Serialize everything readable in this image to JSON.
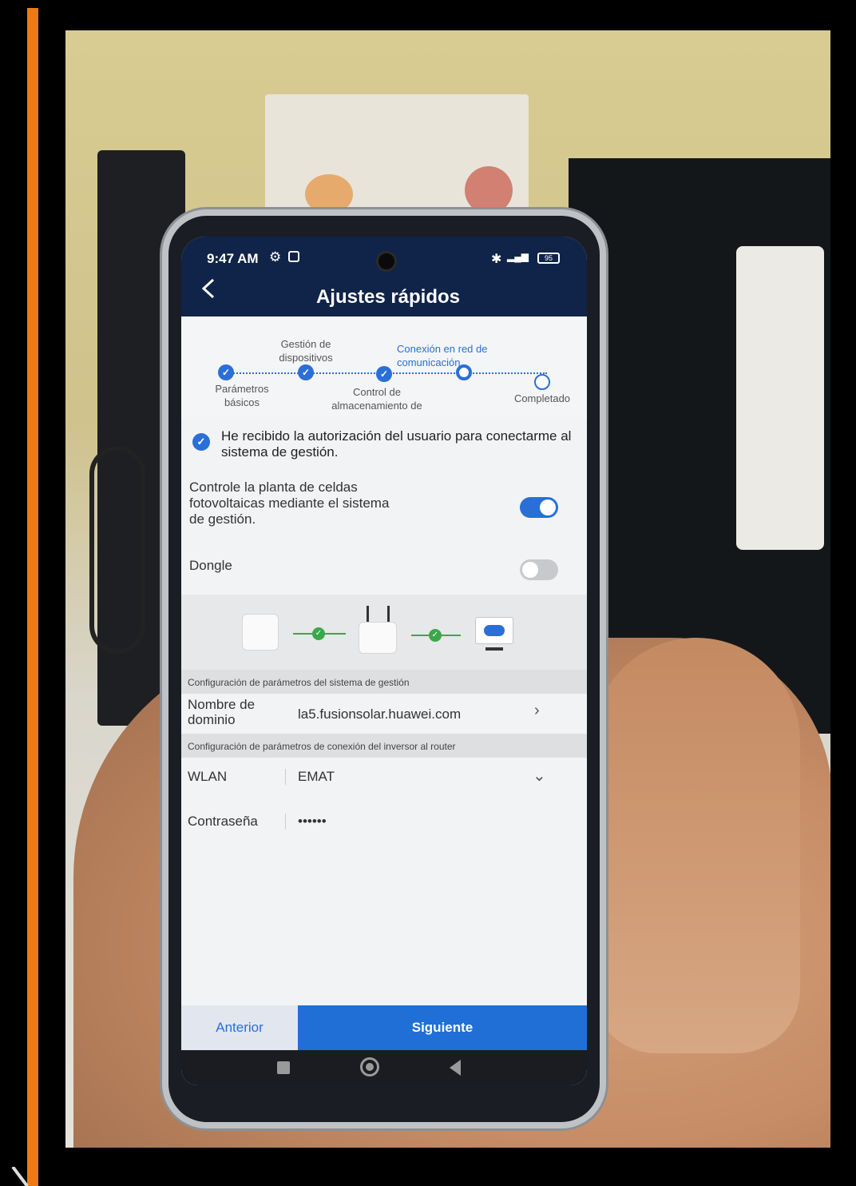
{
  "status_bar": {
    "time": "9:47 AM",
    "gear_icon": "gear-icon",
    "battery": "95"
  },
  "header": {
    "title": "Ajustes rápidos",
    "back_icon": "chevron-left-icon"
  },
  "steps": [
    {
      "label": "Parámetros básicos",
      "state": "done"
    },
    {
      "label": "Gestión de dispositivos",
      "state": "done"
    },
    {
      "label": "Control de almacenamiento de",
      "state": "done"
    },
    {
      "label": "Conexión en red de comunicación",
      "state": "current"
    },
    {
      "label": "Completado",
      "state": "pending"
    }
  ],
  "authorization": {
    "text": "He recibido la autorización del usuario para conectarme al sistema de gestión.",
    "checked": true
  },
  "control_plant": {
    "label": "Controle la planta de celdas fotovoltaicas mediante el sistema de gestión.",
    "enabled": true
  },
  "dongle": {
    "label": "Dongle",
    "enabled": false
  },
  "management_section": {
    "header": "Configuración de parámetros del sistema de gestión",
    "domain_label": "Nombre de dominio",
    "domain_value": "la5.fusionsolar.huawei.com"
  },
  "router_section": {
    "header": "Configuración de parámetros de conexión del inversor al router",
    "wlan_label": "WLAN",
    "wlan_value": "EMAT",
    "password_label": "Contraseña",
    "password_value": "••••••"
  },
  "footer": {
    "prev_label": "Anterior",
    "next_label": "Siguiente"
  },
  "colors": {
    "accent": "#2a6fd6",
    "header_bg": "#102449",
    "orange_bar": "#f07a12"
  }
}
